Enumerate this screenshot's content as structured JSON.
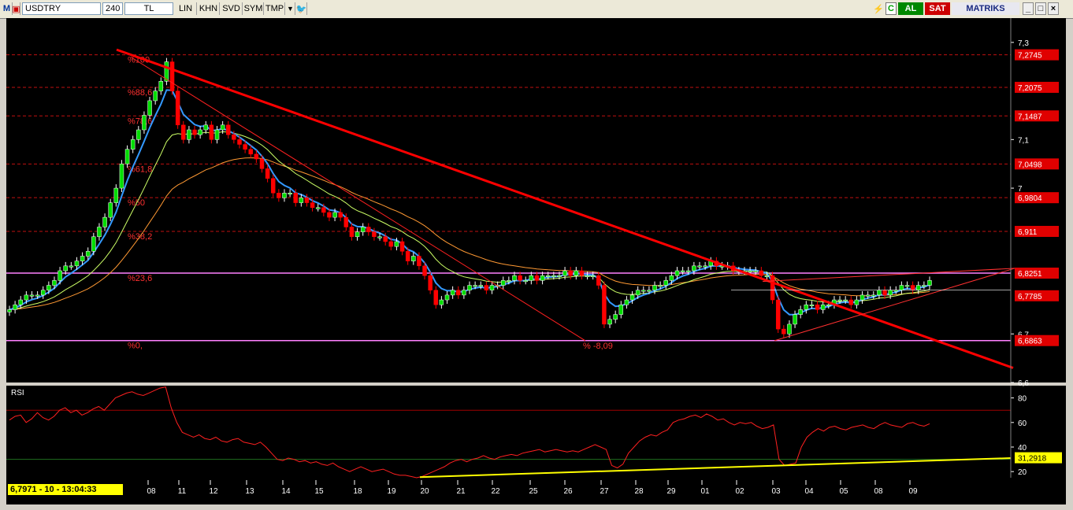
{
  "toolbar": {
    "logo": "M",
    "symbol": "USDTRY",
    "period": "240",
    "currency": "TL",
    "buttons": [
      "LIN",
      "KHN",
      "SVD",
      "SYM",
      "TMP"
    ],
    "buy_label": "AL",
    "sell_label": "SAT",
    "brand": "MATRIKS"
  },
  "status": {
    "readout": "6,7971 - 10 - 13:04:33"
  },
  "colors": {
    "up": "#00dd00",
    "down": "#ff0000",
    "bg": "#000000",
    "accent": "#ff3030",
    "rsi": "#ff2020",
    "trend": "#ffff00",
    "magenta": "#ff80ff"
  },
  "chart_data": [
    {
      "type": "candlestick",
      "title": "",
      "x_ticks": [
        "08",
        "11",
        "12",
        "13",
        "14",
        "15",
        "18",
        "19",
        "20",
        "21",
        "22",
        "25",
        "26",
        "27",
        "28",
        "29",
        "01",
        "02",
        "03",
        "04",
        "05",
        "08",
        "09"
      ],
      "y_ticks": [
        "7,3",
        "7,1",
        "7",
        "6,7",
        "6,6"
      ],
      "ylim": [
        6.6,
        7.35
      ],
      "price_labels": [
        {
          "value": 7.2745,
          "text": "7,2745"
        },
        {
          "value": 7.2075,
          "text": "7,2075"
        },
        {
          "value": 7.1487,
          "text": "7,1487"
        },
        {
          "value": 7.0498,
          "text": "7,0498"
        },
        {
          "value": 6.9804,
          "text": "6,9804"
        },
        {
          "value": 6.911,
          "text": "6,911"
        },
        {
          "value": 6.8251,
          "text": "6,8251"
        },
        {
          "value": 6.7785,
          "text": "6,7785"
        },
        {
          "value": 6.6863,
          "text": "6,6863"
        }
      ],
      "fib_levels": [
        {
          "value": 7.2745,
          "label": "%100"
        },
        {
          "value": 7.2075,
          "label": "%88,6"
        },
        {
          "value": 7.1487,
          "label": "%78,6"
        },
        {
          "value": 7.0498,
          "label": "%61,8"
        },
        {
          "value": 6.9804,
          "label": "%50"
        },
        {
          "value": 6.911,
          "label": "%38,2"
        },
        {
          "value": 6.8251,
          "label": "%23,6"
        },
        {
          "value": 6.6863,
          "label": "%0,"
        }
      ],
      "annotation": "% -8,09",
      "close": [
        6.75,
        6.76,
        6.77,
        6.78,
        6.78,
        6.78,
        6.79,
        6.8,
        6.81,
        6.83,
        6.84,
        6.84,
        6.85,
        6.86,
        6.87,
        6.9,
        6.92,
        6.94,
        6.97,
        7.0,
        7.05,
        7.08,
        7.1,
        7.12,
        7.15,
        7.18,
        7.2,
        7.22,
        7.26,
        7.2,
        7.13,
        7.1,
        7.12,
        7.11,
        7.12,
        7.13,
        7.1,
        7.12,
        7.13,
        7.11,
        7.1,
        7.09,
        7.08,
        7.07,
        7.06,
        7.04,
        7.02,
        6.99,
        6.98,
        6.99,
        6.99,
        6.97,
        6.98,
        6.97,
        6.96,
        6.96,
        6.95,
        6.94,
        6.95,
        6.94,
        6.92,
        6.9,
        6.91,
        6.92,
        6.91,
        6.9,
        6.9,
        6.89,
        6.88,
        6.89,
        6.87,
        6.85,
        6.86,
        6.84,
        6.82,
        6.79,
        6.76,
        6.77,
        6.78,
        6.79,
        6.78,
        6.79,
        6.8,
        6.8,
        6.8,
        6.79,
        6.8,
        6.8,
        6.81,
        6.81,
        6.82,
        6.81,
        6.81,
        6.82,
        6.81,
        6.82,
        6.82,
        6.82,
        6.82,
        6.83,
        6.82,
        6.83,
        6.82,
        6.82,
        6.82,
        6.8,
        6.72,
        6.73,
        6.74,
        6.76,
        6.77,
        6.78,
        6.79,
        6.79,
        6.79,
        6.8,
        6.8,
        6.81,
        6.82,
        6.83,
        6.83,
        6.83,
        6.84,
        6.84,
        6.84,
        6.85,
        6.84,
        6.84,
        6.84,
        6.83,
        6.83,
        6.83,
        6.83,
        6.83,
        6.82,
        6.82,
        6.77,
        6.71,
        6.7,
        6.72,
        6.74,
        6.75,
        6.76,
        6.76,
        6.75,
        6.76,
        6.76,
        6.77,
        6.77,
        6.77,
        6.76,
        6.77,
        6.78,
        6.78,
        6.78,
        6.79,
        6.78,
        6.79,
        6.79,
        6.8,
        6.8,
        6.79,
        6.8,
        6.8,
        6.81
      ],
      "ema_fast": {
        "name": "",
        "color": "#3399ff"
      },
      "ema_mid": {
        "name": "",
        "color": "#ccff66"
      },
      "ema_slow": {
        "name": "",
        "color": "#ff9933"
      }
    },
    {
      "type": "line",
      "title": "RSI",
      "y_ticks": [
        "80",
        "60",
        "40",
        "20"
      ],
      "ylim": [
        15,
        90
      ],
      "levels": [
        70,
        30
      ],
      "current_label": "31,2918",
      "values": [
        62,
        65,
        66,
        60,
        63,
        68,
        64,
        62,
        65,
        70,
        72,
        68,
        70,
        66,
        68,
        71,
        73,
        70,
        75,
        80,
        82,
        84,
        85,
        83,
        82,
        84,
        86,
        88,
        89,
        72,
        60,
        52,
        50,
        48,
        50,
        47,
        46,
        48,
        45,
        44,
        46,
        47,
        44,
        43,
        42,
        44,
        40,
        35,
        30,
        29,
        31,
        30,
        28,
        29,
        27,
        28,
        26,
        25,
        27,
        24,
        22,
        20,
        22,
        24,
        22,
        20,
        21,
        22,
        20,
        18,
        17,
        17,
        16,
        15,
        16,
        18,
        20,
        22,
        24,
        27,
        29,
        30,
        28,
        30,
        31,
        33,
        31,
        30,
        32,
        33,
        34,
        33,
        35,
        36,
        37,
        38,
        36,
        37,
        38,
        37,
        36,
        37,
        36,
        38,
        40,
        42,
        40,
        38,
        25,
        23,
        26,
        35,
        40,
        45,
        48,
        50,
        49,
        52,
        54,
        60,
        62,
        63,
        65,
        66,
        64,
        67,
        65,
        62,
        63,
        60,
        58,
        60,
        59,
        60,
        57,
        55,
        56,
        58,
        30,
        25,
        26,
        27,
        40,
        48,
        52,
        55,
        53,
        56,
        57,
        55,
        54,
        56,
        57,
        58,
        56,
        55,
        58,
        60,
        58,
        57,
        56,
        59,
        60,
        58,
        57,
        59
      ]
    }
  ]
}
